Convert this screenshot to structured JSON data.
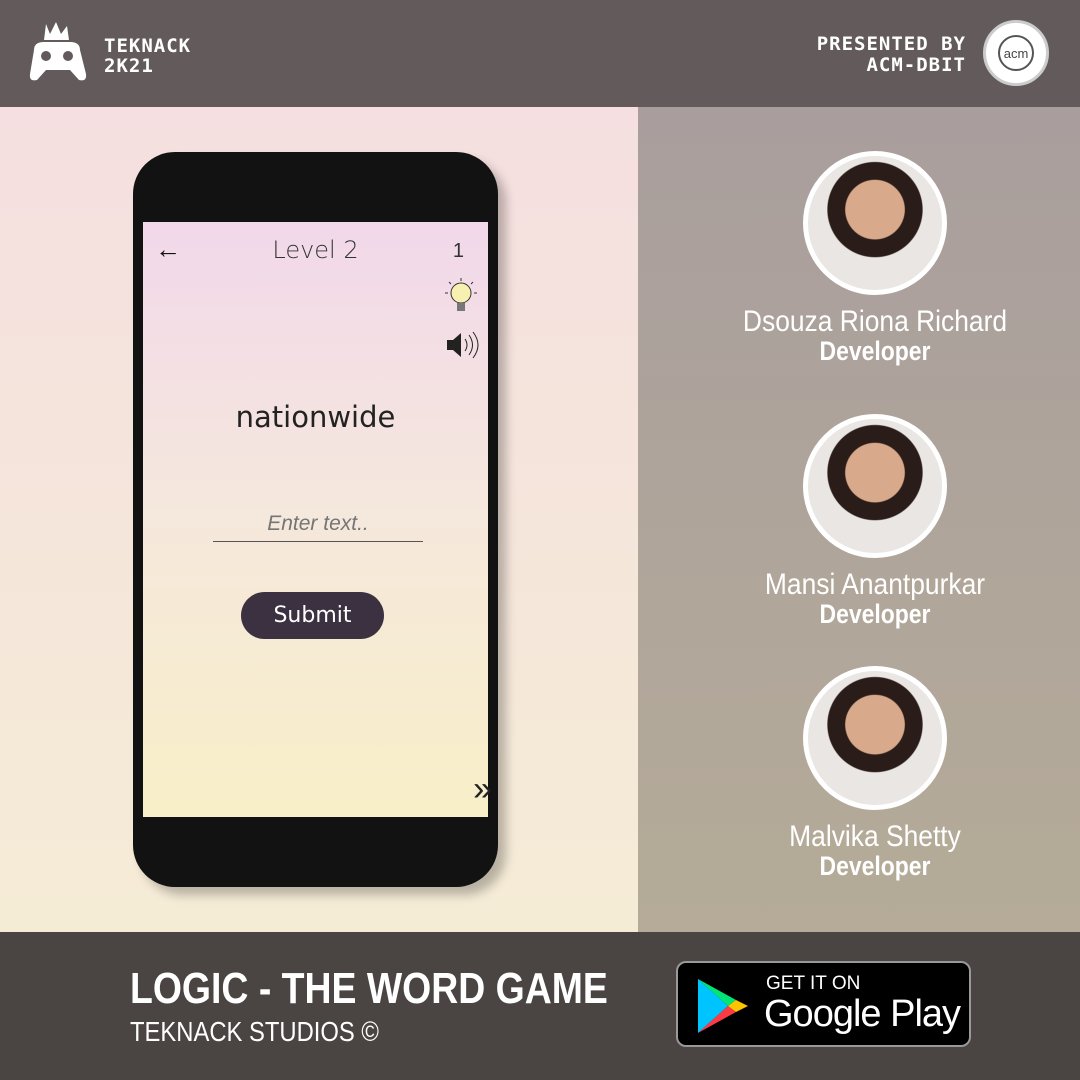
{
  "header": {
    "brand_line1": "TEKNACK",
    "brand_line2": "2K21",
    "presented_line1": "PRESENTED BY",
    "presented_line2": "ACM-DBIT",
    "acm_logo_text": "acm"
  },
  "app": {
    "level": "Level 2",
    "score": "1",
    "word": "nationwide",
    "input_placeholder": "Enter text..",
    "submit_label": "Submit",
    "back_icon": "←",
    "next_icon": "»"
  },
  "team": [
    {
      "name": "Dsouza Riona Richard",
      "role": "Developer"
    },
    {
      "name": "Mansi Anantpurkar",
      "role": "Developer"
    },
    {
      "name": "Malvika Shetty",
      "role": "Developer"
    }
  ],
  "footer": {
    "title": "LOGIC - THE WORD GAME",
    "studio": "TEKNACK STUDIOS ©",
    "badge_line1": "GET IT ON",
    "badge_line2": "Google Play"
  }
}
